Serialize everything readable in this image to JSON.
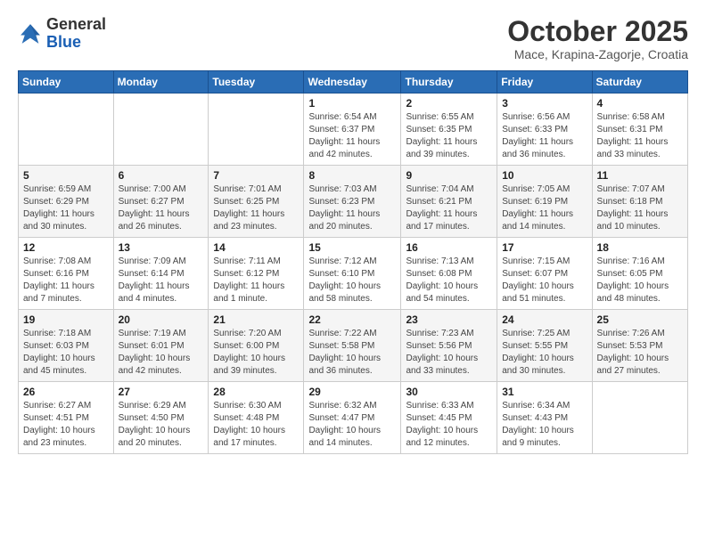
{
  "logo": {
    "general": "General",
    "blue": "Blue"
  },
  "header": {
    "month": "October 2025",
    "location": "Mace, Krapina-Zagorje, Croatia"
  },
  "weekdays": [
    "Sunday",
    "Monday",
    "Tuesday",
    "Wednesday",
    "Thursday",
    "Friday",
    "Saturday"
  ],
  "weeks": [
    [
      {
        "day": "",
        "info": ""
      },
      {
        "day": "",
        "info": ""
      },
      {
        "day": "",
        "info": ""
      },
      {
        "day": "1",
        "info": "Sunrise: 6:54 AM\nSunset: 6:37 PM\nDaylight: 11 hours and 42 minutes."
      },
      {
        "day": "2",
        "info": "Sunrise: 6:55 AM\nSunset: 6:35 PM\nDaylight: 11 hours and 39 minutes."
      },
      {
        "day": "3",
        "info": "Sunrise: 6:56 AM\nSunset: 6:33 PM\nDaylight: 11 hours and 36 minutes."
      },
      {
        "day": "4",
        "info": "Sunrise: 6:58 AM\nSunset: 6:31 PM\nDaylight: 11 hours and 33 minutes."
      }
    ],
    [
      {
        "day": "5",
        "info": "Sunrise: 6:59 AM\nSunset: 6:29 PM\nDaylight: 11 hours and 30 minutes."
      },
      {
        "day": "6",
        "info": "Sunrise: 7:00 AM\nSunset: 6:27 PM\nDaylight: 11 hours and 26 minutes."
      },
      {
        "day": "7",
        "info": "Sunrise: 7:01 AM\nSunset: 6:25 PM\nDaylight: 11 hours and 23 minutes."
      },
      {
        "day": "8",
        "info": "Sunrise: 7:03 AM\nSunset: 6:23 PM\nDaylight: 11 hours and 20 minutes."
      },
      {
        "day": "9",
        "info": "Sunrise: 7:04 AM\nSunset: 6:21 PM\nDaylight: 11 hours and 17 minutes."
      },
      {
        "day": "10",
        "info": "Sunrise: 7:05 AM\nSunset: 6:19 PM\nDaylight: 11 hours and 14 minutes."
      },
      {
        "day": "11",
        "info": "Sunrise: 7:07 AM\nSunset: 6:18 PM\nDaylight: 11 hours and 10 minutes."
      }
    ],
    [
      {
        "day": "12",
        "info": "Sunrise: 7:08 AM\nSunset: 6:16 PM\nDaylight: 11 hours and 7 minutes."
      },
      {
        "day": "13",
        "info": "Sunrise: 7:09 AM\nSunset: 6:14 PM\nDaylight: 11 hours and 4 minutes."
      },
      {
        "day": "14",
        "info": "Sunrise: 7:11 AM\nSunset: 6:12 PM\nDaylight: 11 hours and 1 minute."
      },
      {
        "day": "15",
        "info": "Sunrise: 7:12 AM\nSunset: 6:10 PM\nDaylight: 10 hours and 58 minutes."
      },
      {
        "day": "16",
        "info": "Sunrise: 7:13 AM\nSunset: 6:08 PM\nDaylight: 10 hours and 54 minutes."
      },
      {
        "day": "17",
        "info": "Sunrise: 7:15 AM\nSunset: 6:07 PM\nDaylight: 10 hours and 51 minutes."
      },
      {
        "day": "18",
        "info": "Sunrise: 7:16 AM\nSunset: 6:05 PM\nDaylight: 10 hours and 48 minutes."
      }
    ],
    [
      {
        "day": "19",
        "info": "Sunrise: 7:18 AM\nSunset: 6:03 PM\nDaylight: 10 hours and 45 minutes."
      },
      {
        "day": "20",
        "info": "Sunrise: 7:19 AM\nSunset: 6:01 PM\nDaylight: 10 hours and 42 minutes."
      },
      {
        "day": "21",
        "info": "Sunrise: 7:20 AM\nSunset: 6:00 PM\nDaylight: 10 hours and 39 minutes."
      },
      {
        "day": "22",
        "info": "Sunrise: 7:22 AM\nSunset: 5:58 PM\nDaylight: 10 hours and 36 minutes."
      },
      {
        "day": "23",
        "info": "Sunrise: 7:23 AM\nSunset: 5:56 PM\nDaylight: 10 hours and 33 minutes."
      },
      {
        "day": "24",
        "info": "Sunrise: 7:25 AM\nSunset: 5:55 PM\nDaylight: 10 hours and 30 minutes."
      },
      {
        "day": "25",
        "info": "Sunrise: 7:26 AM\nSunset: 5:53 PM\nDaylight: 10 hours and 27 minutes."
      }
    ],
    [
      {
        "day": "26",
        "info": "Sunrise: 6:27 AM\nSunset: 4:51 PM\nDaylight: 10 hours and 23 minutes."
      },
      {
        "day": "27",
        "info": "Sunrise: 6:29 AM\nSunset: 4:50 PM\nDaylight: 10 hours and 20 minutes."
      },
      {
        "day": "28",
        "info": "Sunrise: 6:30 AM\nSunset: 4:48 PM\nDaylight: 10 hours and 17 minutes."
      },
      {
        "day": "29",
        "info": "Sunrise: 6:32 AM\nSunset: 4:47 PM\nDaylight: 10 hours and 14 minutes."
      },
      {
        "day": "30",
        "info": "Sunrise: 6:33 AM\nSunset: 4:45 PM\nDaylight: 10 hours and 12 minutes."
      },
      {
        "day": "31",
        "info": "Sunrise: 6:34 AM\nSunset: 4:43 PM\nDaylight: 10 hours and 9 minutes."
      },
      {
        "day": "",
        "info": ""
      }
    ]
  ]
}
